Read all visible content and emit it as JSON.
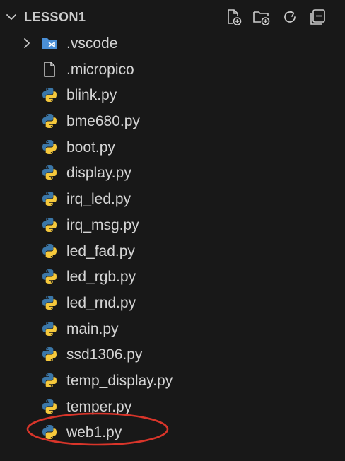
{
  "explorer": {
    "folder_name": "LESSON1",
    "actions": [
      {
        "name": "new-file",
        "icon": "new-file-icon"
      },
      {
        "name": "new-folder",
        "icon": "new-folder-icon"
      },
      {
        "name": "refresh",
        "icon": "refresh-icon"
      },
      {
        "name": "collapse-all",
        "icon": "collapse-all-icon"
      }
    ],
    "items": [
      {
        "label": ".vscode",
        "type": "folder",
        "icon": "vscode-folder-icon",
        "expanded": false
      },
      {
        "label": ".micropico",
        "type": "file",
        "icon": "file-icon"
      },
      {
        "label": "blink.py",
        "type": "python",
        "icon": "python-icon"
      },
      {
        "label": "bme680.py",
        "type": "python",
        "icon": "python-icon"
      },
      {
        "label": "boot.py",
        "type": "python",
        "icon": "python-icon"
      },
      {
        "label": "display.py",
        "type": "python",
        "icon": "python-icon"
      },
      {
        "label": "irq_led.py",
        "type": "python",
        "icon": "python-icon"
      },
      {
        "label": "irq_msg.py",
        "type": "python",
        "icon": "python-icon"
      },
      {
        "label": "led_fad.py",
        "type": "python",
        "icon": "python-icon"
      },
      {
        "label": "led_rgb.py",
        "type": "python",
        "icon": "python-icon"
      },
      {
        "label": "led_rnd.py",
        "type": "python",
        "icon": "python-icon"
      },
      {
        "label": "main.py",
        "type": "python",
        "icon": "python-icon"
      },
      {
        "label": "ssd1306.py",
        "type": "python",
        "icon": "python-icon"
      },
      {
        "label": "temp_display.py",
        "type": "python",
        "icon": "python-icon"
      },
      {
        "label": "temper.py",
        "type": "python",
        "icon": "python-icon"
      },
      {
        "label": "web1.py",
        "type": "python",
        "icon": "python-icon",
        "highlighted": true
      }
    ]
  },
  "colors": {
    "background": "#181818",
    "text": "#cccccc",
    "python_blue": "#3b77a8",
    "python_yellow": "#f6c93c",
    "vscode_folder": "#4a8fd6",
    "highlight_circle": "#d9352a"
  }
}
